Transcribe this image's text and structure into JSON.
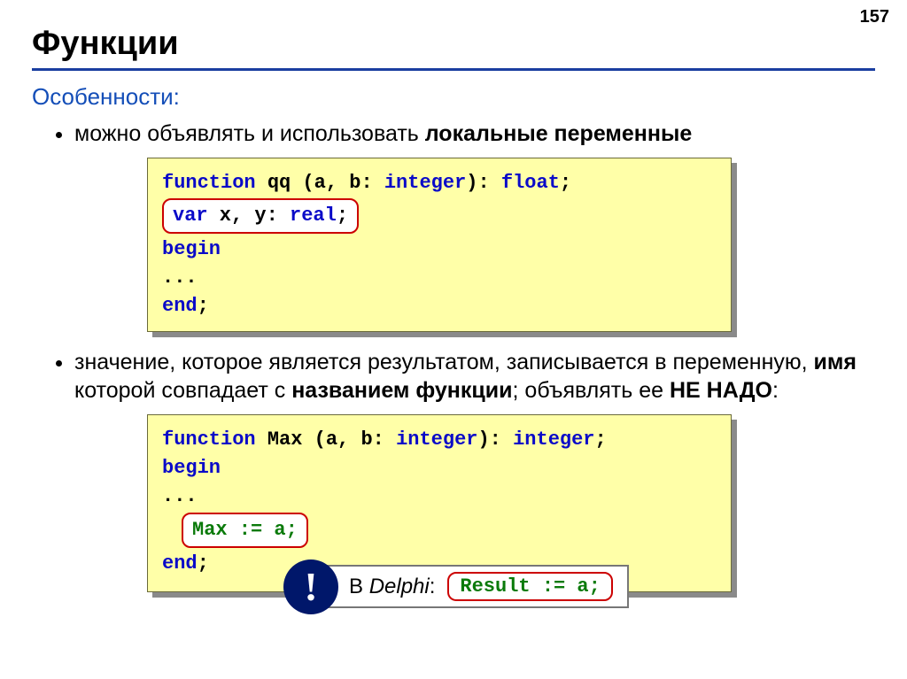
{
  "page_number": "157",
  "title": "Функции",
  "subheading": "Особенности:",
  "bullets": {
    "b1_part1": "можно объявлять и использовать ",
    "b1_bold": "локальные переменные",
    "b2_part1": "значение, которое является результатом, записывается в переменную, ",
    "b2_bold1": "имя",
    "b2_part2": " которой совпадает с ",
    "b2_bold2": "названием функции",
    "b2_part3": "; объявлять ее ",
    "b2_bold3": "НЕ НАДО",
    "b2_part4": ":"
  },
  "code1": {
    "kw_function": "function",
    "name": " qq (a, b: ",
    "kw_integer": "integer",
    "after_int": "): ",
    "kw_float": "float",
    "semi": ";",
    "kw_var": "var",
    "vars": " x, y: ",
    "kw_real": "real",
    "semi2": ";",
    "kw_begin": "begin",
    "dots": "  ...",
    "kw_end": "end",
    "semi3": ";"
  },
  "code2": {
    "kw_function": "function",
    "name": " Max (a, b: ",
    "kw_integer": "integer",
    "after_int": "): ",
    "kw_integer2": "integer",
    "semi": ";",
    "kw_begin": "begin",
    "dots": "  ...",
    "assign": "Max := a;",
    "kw_end": "end",
    "semi3": ";"
  },
  "delphi": {
    "excl": "!",
    "prefix": "В ",
    "label": "Delphi",
    "suffix": ":",
    "result": "Result := a;"
  }
}
